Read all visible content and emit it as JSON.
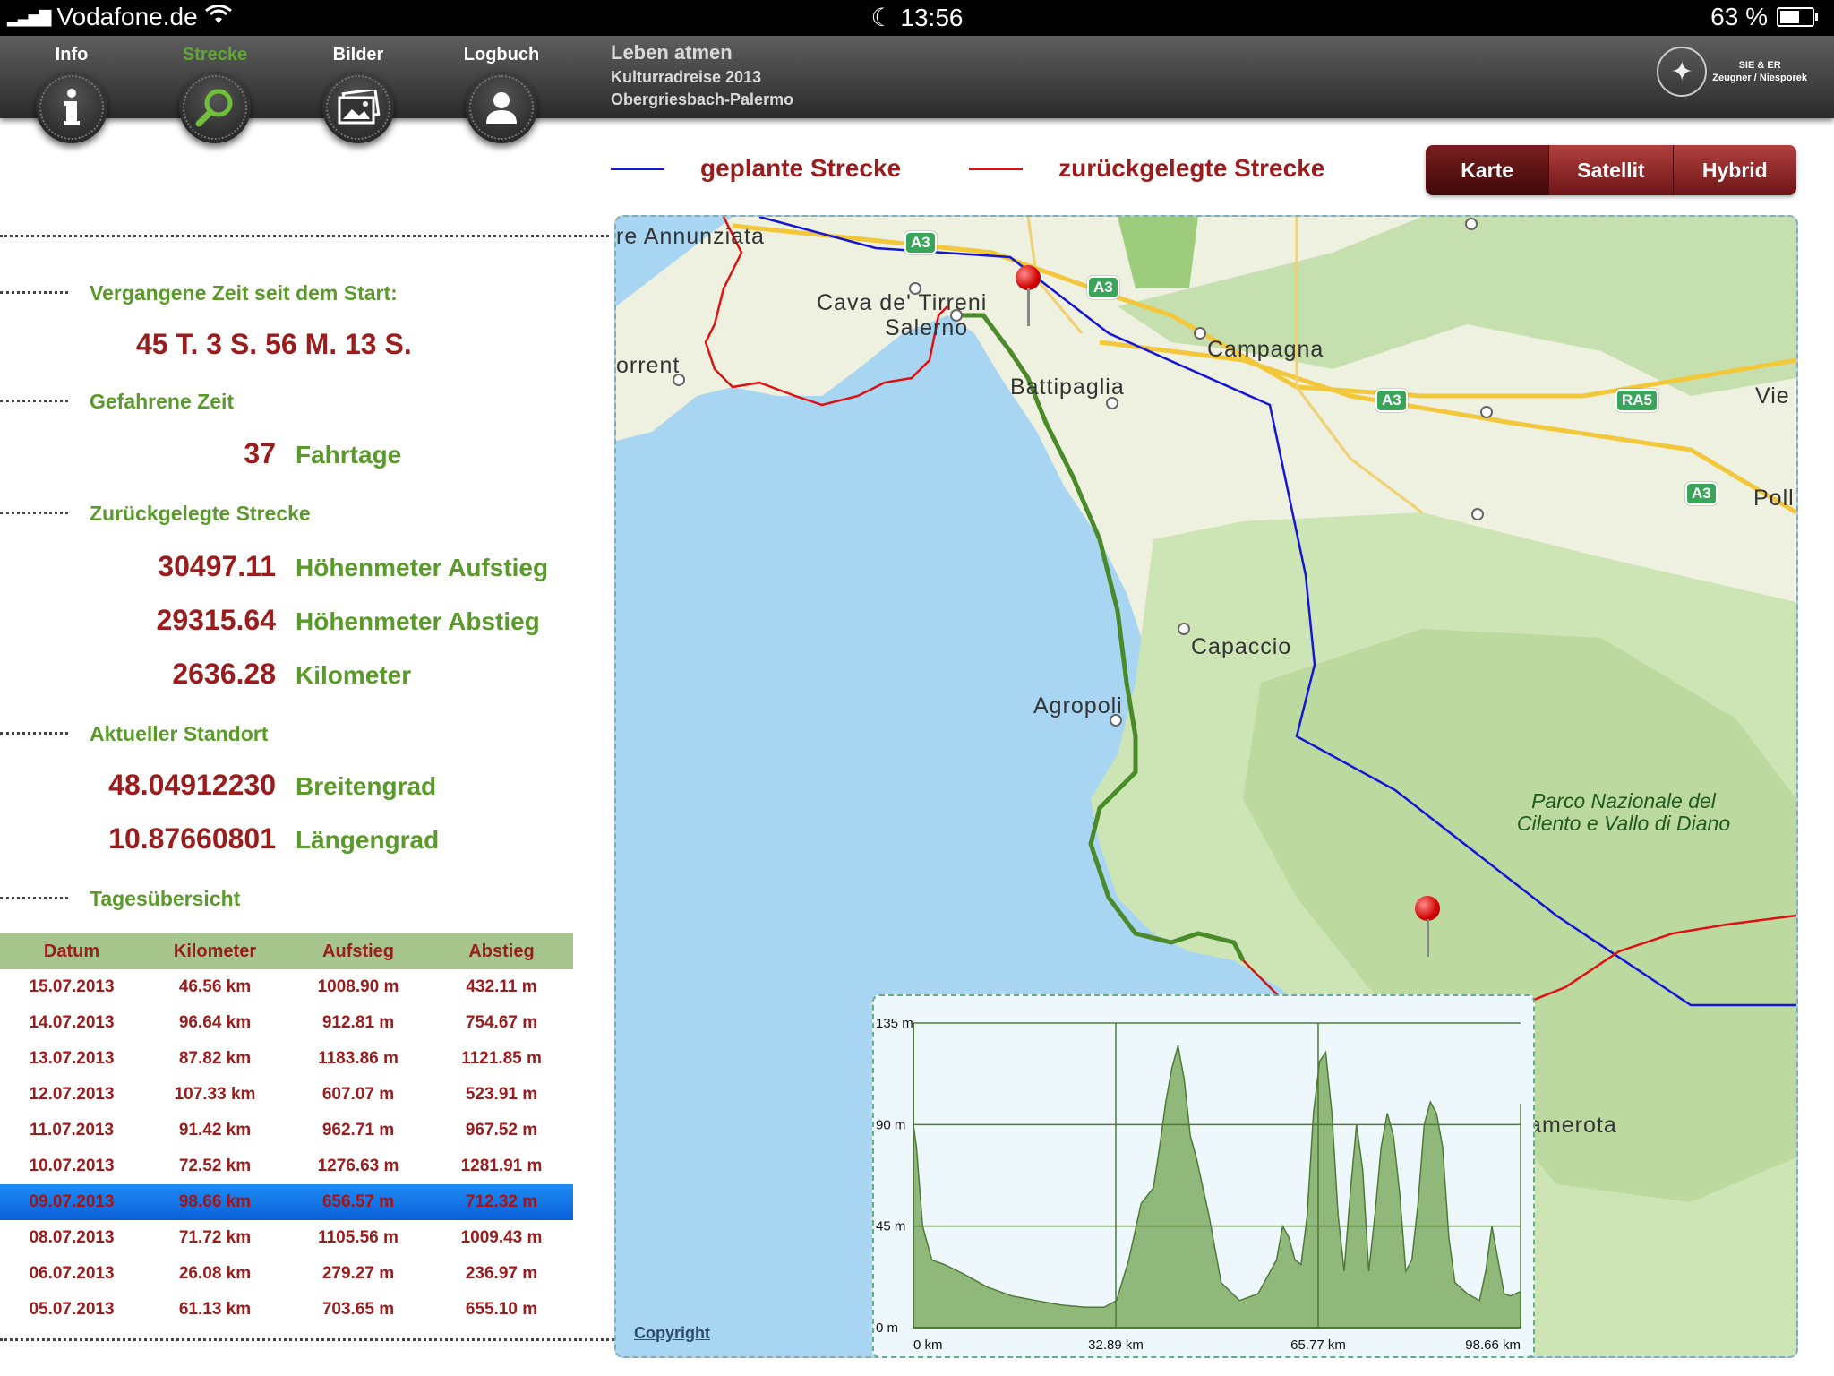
{
  "status": {
    "carrier": "Vodafone.de",
    "time": "13:56",
    "battery": "63 %",
    "battery_level": 0.63
  },
  "nav": {
    "tabs": [
      {
        "label": "Info",
        "icon": "info-icon"
      },
      {
        "label": "Strecke",
        "icon": "search-icon"
      },
      {
        "label": "Bilder",
        "icon": "picture-icon"
      },
      {
        "label": "Logbuch",
        "icon": "user-icon"
      }
    ],
    "active": "Strecke"
  },
  "trip": {
    "title": "Leben atmen",
    "subtitle": "Kulturradreise 2013",
    "route": "Obergriesbach-Palermo"
  },
  "logo": {
    "line1": "SIE & ER",
    "line2": "Zeugner / Niesporek"
  },
  "legend": {
    "planned": "geplante Strecke",
    "traveled": "zurückgelegte Strecke",
    "planned_color": "#1515d6",
    "traveled_color": "#e01010"
  },
  "map_types": {
    "options": [
      "Karte",
      "Satellit",
      "Hybrid"
    ],
    "selected": "Karte"
  },
  "stats": {
    "elapsed_label": "Vergangene Zeit seit dem Start:",
    "elapsed_value": "45 T. 3 S. 56 M. 13 S.",
    "ride_time_label": "Gefahrene Zeit",
    "ride_days": "37",
    "ride_days_unit": "Fahrtage",
    "distance_label": "Zurückgelegte Strecke",
    "ascent": "30497.11",
    "ascent_unit": "Höhenmeter Aufstieg",
    "descent": "29315.64",
    "descent_unit": "Höhenmeter Abstieg",
    "km": "2636.28",
    "km_unit": "Kilometer",
    "location_label": "Aktueller Standort",
    "lat": "48.04912230",
    "lat_unit": "Breitengrad",
    "lon": "10.87660801",
    "lon_unit": "Längengrad",
    "daily_label": "Tagesübersicht"
  },
  "table": {
    "headers": [
      "Datum",
      "Kilometer",
      "Aufstieg",
      "Abstieg"
    ],
    "rows": [
      [
        "15.07.2013",
        "46.56 km",
        "1008.90 m",
        "432.11 m"
      ],
      [
        "14.07.2013",
        "96.64 km",
        "912.81 m",
        "754.67 m"
      ],
      [
        "13.07.2013",
        "87.82 km",
        "1183.86 m",
        "1121.85 m"
      ],
      [
        "12.07.2013",
        "107.33 km",
        "607.07 m",
        "523.91 m"
      ],
      [
        "11.07.2013",
        "91.42 km",
        "962.71 m",
        "967.52 m"
      ],
      [
        "10.07.2013",
        "72.52 km",
        "1276.63 m",
        "1281.91 m"
      ],
      [
        "09.07.2013",
        "98.66 km",
        "656.57 m",
        "712.32 m"
      ],
      [
        "08.07.2013",
        "71.72 km",
        "1105.56 m",
        "1009.43 m"
      ],
      [
        "06.07.2013",
        "26.08 km",
        "279.27 m",
        "236.97 m"
      ],
      [
        "05.07.2013",
        "61.13 km",
        "703.65 m",
        "655.10 m"
      ]
    ],
    "selected_index": 6
  },
  "map": {
    "labels": [
      "re Annunziata",
      "Cava de' Tirreni",
      "Salerno",
      "orrent",
      "Campagna",
      "Battipaglia",
      "Capaccio",
      "Agropoli",
      "Vie",
      "Poll",
      "Camerota"
    ],
    "park": "Parco Nazionale del Cilento e Vallo di Diano",
    "shields": [
      "A3",
      "A3",
      "A3",
      "RA5",
      "A3"
    ],
    "copyright": "Copyright"
  },
  "chart_data": {
    "type": "area",
    "x_ticks": [
      "0 km",
      "32.89 km",
      "65.77 km",
      "98.66 km"
    ],
    "y_ticks": [
      "0 m",
      "45 m",
      "90 m",
      "135 m"
    ],
    "xlim": [
      0,
      98.66
    ],
    "ylim": [
      0,
      135
    ],
    "x": [
      0,
      0.5,
      1.5,
      3,
      5,
      8,
      12,
      16,
      20,
      24,
      28,
      31,
      33,
      35,
      37,
      39,
      40,
      41,
      42,
      43,
      44,
      45,
      46,
      48,
      50,
      53,
      56,
      58,
      59,
      60,
      61,
      62,
      63,
      64,
      65,
      66,
      67,
      68,
      69,
      70,
      71,
      72,
      73,
      74,
      75,
      76,
      77,
      78,
      79,
      80,
      81,
      82,
      83,
      84,
      85,
      86,
      87,
      88,
      90,
      92,
      93,
      94,
      95,
      96,
      97,
      98.66
    ],
    "y": [
      90,
      80,
      45,
      30,
      28,
      24,
      18,
      14,
      12,
      10,
      9,
      9,
      12,
      30,
      55,
      62,
      80,
      100,
      115,
      125,
      110,
      85,
      75,
      50,
      20,
      12,
      15,
      25,
      30,
      45,
      40,
      30,
      28,
      50,
      95,
      118,
      122,
      95,
      50,
      25,
      60,
      90,
      70,
      25,
      50,
      80,
      95,
      85,
      60,
      25,
      30,
      55,
      90,
      100,
      95,
      80,
      40,
      20,
      15,
      12,
      25,
      45,
      30,
      15,
      14,
      16
    ]
  }
}
